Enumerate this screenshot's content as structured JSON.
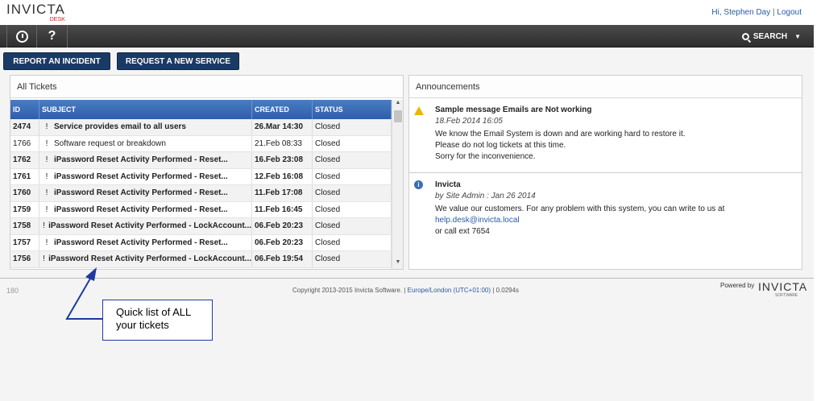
{
  "header": {
    "logo_main": "INVICTA",
    "logo_sub": "DESK",
    "greeting": "Hi, Stephen Day",
    "separator": "|",
    "logout": "Logout"
  },
  "navbar": {
    "clock_icon": "clock-icon",
    "help_label": "?",
    "search_label": "SEARCH",
    "search_caret": "▼"
  },
  "actions": {
    "report_incident": "REPORT AN INCIDENT",
    "request_service": "REQUEST A NEW SERVICE"
  },
  "tickets": {
    "title": "All Tickets",
    "columns": [
      "ID",
      "SUBJECT",
      "CREATED",
      "STATUS"
    ],
    "rows": [
      {
        "id": "2474",
        "subject": "Service provides email to all users",
        "created": "26.Mar 14:30",
        "status": "Closed",
        "bold": true
      },
      {
        "id": "1766",
        "subject": "Software request or breakdown",
        "created": "21.Feb 08:33",
        "status": "Closed",
        "bold": false
      },
      {
        "id": "1762",
        "subject": "iPassword Reset Activity Performed - Reset...",
        "created": "16.Feb 23:08",
        "status": "Closed",
        "bold": true
      },
      {
        "id": "1761",
        "subject": "iPassword Reset Activity Performed - Reset...",
        "created": "12.Feb 16:08",
        "status": "Closed",
        "bold": true
      },
      {
        "id": "1760",
        "subject": "iPassword Reset Activity Performed - Reset...",
        "created": "11.Feb 17:08",
        "status": "Closed",
        "bold": true
      },
      {
        "id": "1759",
        "subject": "iPassword Reset Activity Performed - Reset...",
        "created": "11.Feb 16:45",
        "status": "Closed",
        "bold": true
      },
      {
        "id": "1758",
        "subject": "iPassword Reset Activity Performed - LockAccount...",
        "created": "06.Feb 20:23",
        "status": "Closed",
        "bold": true
      },
      {
        "id": "1757",
        "subject": "iPassword Reset Activity Performed - Reset...",
        "created": "06.Feb 20:23",
        "status": "Closed",
        "bold": true
      },
      {
        "id": "1756",
        "subject": "iPassword Reset Activity Performed - LockAccount...",
        "created": "06.Feb 19:54",
        "status": "Closed",
        "bold": true
      }
    ],
    "bang": "!"
  },
  "announcements": {
    "title": "Announcements",
    "items": [
      {
        "icon": "warning-icon",
        "title": "Sample message Emails are Not working",
        "meta": "18.Feb 2014 16:05",
        "lines": [
          "We know the Email System is down and are working hard to restore it.",
          "Please do not log tickets at this time.",
          "Sorry for the inconvenience."
        ]
      },
      {
        "icon": "info-icon",
        "title": "Invicta",
        "meta": "by Site Admin : Jan 26 2014",
        "lines": [
          "We value our customers. For any problem with this system, you can write to us at"
        ],
        "link": "help.desk@invicta.local",
        "after_link": "or call ext 7654"
      }
    ]
  },
  "footer": {
    "count": "180",
    "copyright": "Copyright 2013-2015 Invicta Software. |",
    "timezone": "Europe/London (UTC+01:00)",
    "timing": "| 0.0294s",
    "powered_by": "Powered by",
    "powered_logo": "INVICTA",
    "powered_sub": "SOFTWARE"
  },
  "callout": {
    "text": "Quick list of ALL your tickets"
  },
  "colors": {
    "nav_dark": "#2e2e2e",
    "button_navy": "#1a3a66",
    "table_header_blue": "#2e5ea8",
    "link_blue": "#2a5aa8",
    "logo_red": "#cc2222"
  }
}
